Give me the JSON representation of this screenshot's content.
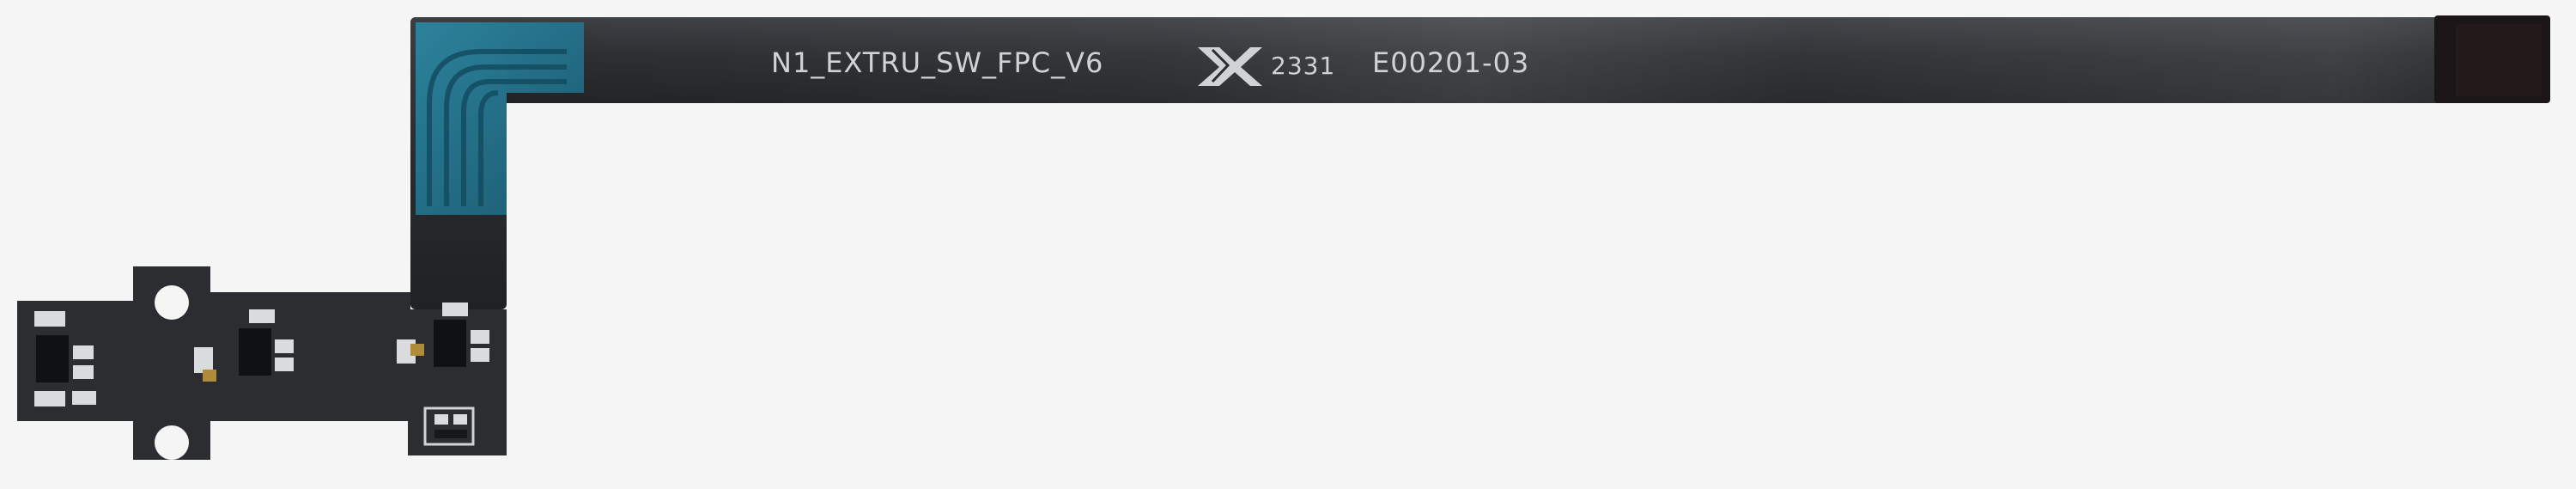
{
  "photo": {
    "background_color": "#f5f5f5",
    "cable_color": "#2a2c2f",
    "silkscreen_color": "#cfd3d6",
    "stiffener_color": "#1f6e88",
    "pad_color": "#d9dbdd",
    "labels": {
      "part_name": "N1_EXTRU_SW_FPC_V6",
      "date_code": "2331",
      "part_number": "E00201-03"
    },
    "logo": "bambu-lab-logo"
  }
}
